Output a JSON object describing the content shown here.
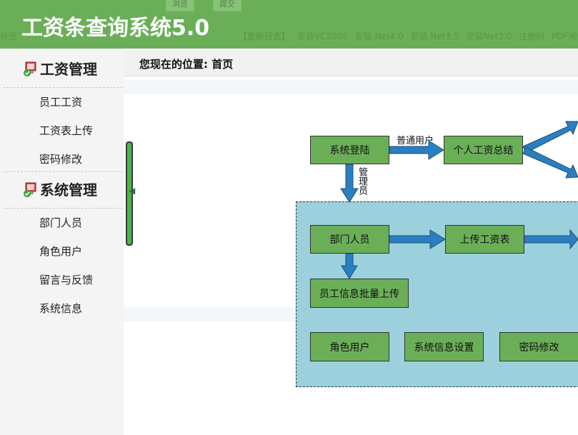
{
  "app": {
    "title": "工资条查询系统5.0"
  },
  "header": {
    "ghost_buttons": [
      "浏览",
      "提交"
    ],
    "ghost_links": [
      "标签",
      "【更新日志】",
      "安装VC2005",
      "安装.Net4.0",
      "安装.Net3.5",
      "安装Net2.0",
      "注册码",
      "PDF阅读器"
    ]
  },
  "sidebar": {
    "sections": [
      {
        "title": "工资管理",
        "icon": "computer-check-icon",
        "items": [
          "员工工资",
          "工资表上传",
          "密码修改"
        ]
      },
      {
        "title": "系统管理",
        "icon": "computer-check-icon",
        "items": [
          "部门人员",
          "角色用户",
          "留言与反馈",
          "系统信息"
        ]
      }
    ]
  },
  "location": {
    "text": "您现在的位置: 首页"
  },
  "flow": {
    "nodes": {
      "login": "系统登陆",
      "summary": "个人工资总结",
      "dept": "部门人员",
      "upload": "上传工资表",
      "batch": "员工信息批量上传",
      "roles": "角色用户",
      "sysinfo": "系统信息设置",
      "pwd": "密码修改"
    },
    "edges": {
      "normal_user": "普通用户",
      "admin": "管理员"
    }
  },
  "colors": {
    "header": "#6aaf58",
    "node": "#6aaf58",
    "admin_region": "#9bd0dc",
    "arrow": "#2a7fc0"
  }
}
